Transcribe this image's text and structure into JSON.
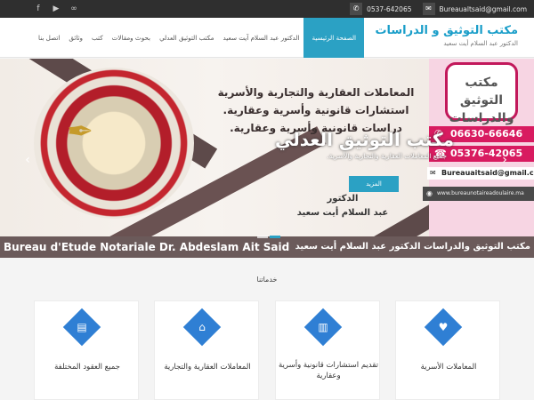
{
  "topbar": {
    "social_icons": [
      "facebook-icon",
      "youtube-icon",
      "link-icon"
    ],
    "phone": "0537-642065",
    "email": "Bureaualtsaid@gmail.com"
  },
  "nav": {
    "brand_title": "مكتب التوثيق و الدراسات",
    "brand_subtitle": "الدكتور عبد السلام أيت سعيد",
    "items": [
      "الصفحة الرئيسية",
      "الدكتور عبد السلام آيت سعيد",
      "مكتب التوثيق العدلي",
      "بحوث ومقالات",
      "كتب",
      "وثائق",
      "اتصل بنا"
    ],
    "active_index": 0
  },
  "hero": {
    "pink_title_line1": "مكتب التوثيق",
    "pink_title_line2": "والدراسات",
    "phone1": "06630-66646",
    "phone2": "05376-42065",
    "email": "Bureauaitsaid@gmail.com",
    "website": "www.bureaunotaireadoulaire.ma",
    "line1": "المعاملات العقارية والتجارية والأسرية",
    "line2": "استشارات قانونية وأسرية وعقارية.",
    "line3": "دراسات قانونية وأسرية وعقارية.",
    "title": "مكتب التوثيق العدلي",
    "description": "جميع المعاملات العقارية والتجارية والأسرية.",
    "button": "المزيد",
    "doctor_line1": "الدكتور",
    "doctor_line2": "عبد السلام أيت سعيد",
    "footer_left": "Bureau d'Etude Notariale Dr. Abdeslam Ait Said",
    "footer_right": "مكتب التوثيق والدراسات الدكتور عبد السلام أيت سعيد",
    "slides": 2,
    "active_slide": 1
  },
  "services": {
    "title": "خدماتنا",
    "cards": [
      {
        "title": "جميع العقود المختلفة",
        "icon": "document-icon",
        "text": "",
        "text2": ""
      },
      {
        "title": "المعاملات العقارية والتجارية",
        "icon": "home-icon",
        "text": "",
        "text2": ""
      },
      {
        "title": "تقديم استشارات قانونية وأسرية وعقارية",
        "icon": "book-icon",
        "text": "",
        "text2": ""
      },
      {
        "title": "المعاملات الأسرية",
        "icon": "family-icon",
        "text": "",
        "text2": ""
      }
    ]
  },
  "colors": {
    "accent": "#2ba1c4",
    "card_icon": "#2f7fd4",
    "hero_pink": "#d81b60",
    "topbar": "#2f2f2f"
  }
}
